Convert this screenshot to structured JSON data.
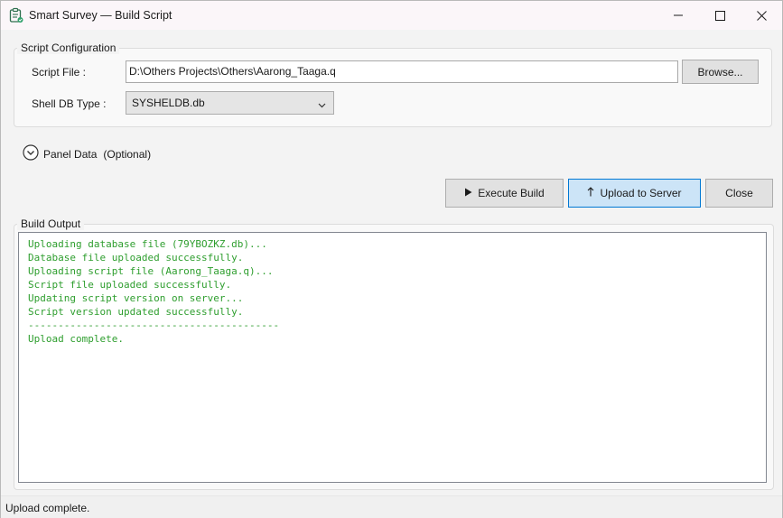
{
  "window": {
    "title": "Smart Survey — Build Script",
    "app_icon": "clipboard-icon",
    "controls": [
      "minimize-icon",
      "maximize-icon",
      "close-icon"
    ]
  },
  "config": {
    "group_title": "Script Configuration",
    "script_file_label": "Script File :",
    "script_file_value": "D:\\Others Projects\\Others\\Aarong_Taaga.q",
    "browse_label": "Browse...",
    "shell_db_label": "Shell DB Type :",
    "shell_db_value": "SYSHELDB.db"
  },
  "panel": {
    "label": "Panel Data",
    "optional": "(Optional)"
  },
  "actions": {
    "execute_label": "Execute Build",
    "execute_icon": "play-icon",
    "upload_label": "Upload to Server",
    "upload_icon": "arrow-up-icon",
    "close_label": "Close"
  },
  "output": {
    "group_title": "Build Output",
    "lines": [
      "Uploading database file (79YBOZKZ.db)...",
      "Database file uploaded successfully.",
      "Uploading script file (Aarong_Taaga.q)...",
      "Script file uploaded successfully.",
      "Updating script version on server...",
      "Script version updated successfully.",
      "------------------------------------------",
      "Upload complete."
    ],
    "text_color": "#2e9e2e"
  },
  "status": {
    "text": "Upload complete."
  },
  "colors": {
    "accent": "#0078d4",
    "primary_button_bg": "#cce4f7"
  }
}
